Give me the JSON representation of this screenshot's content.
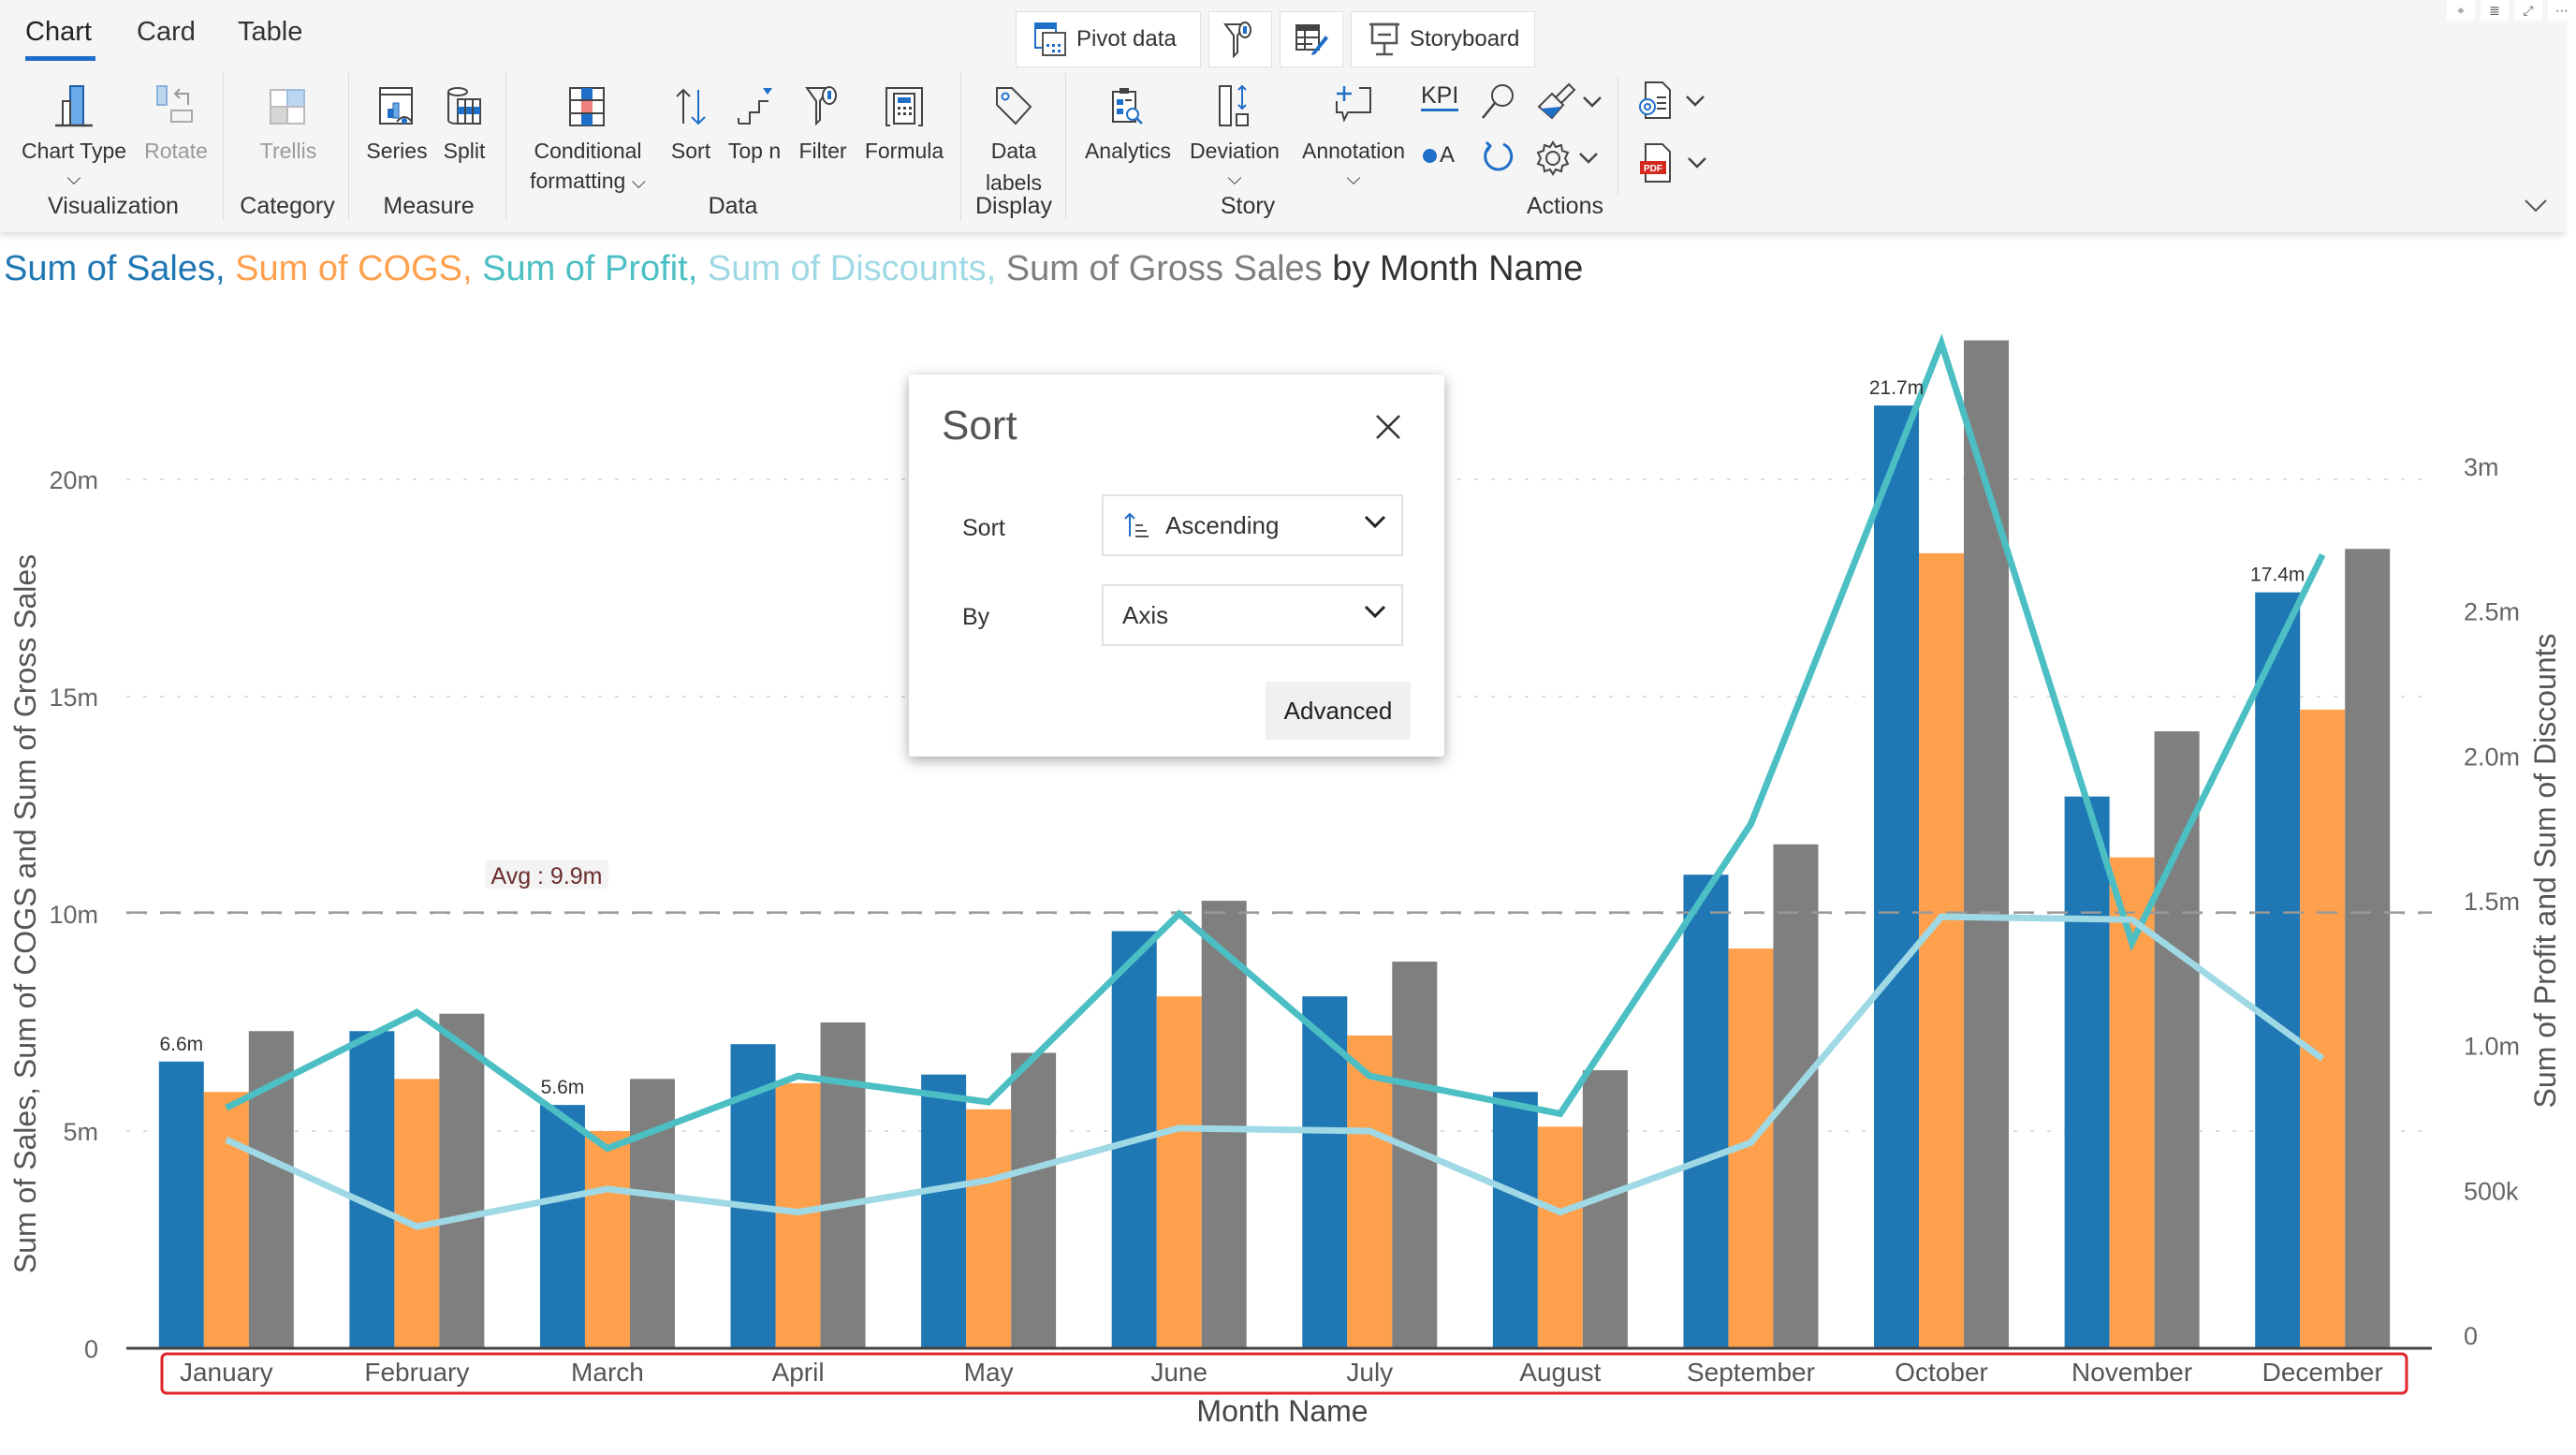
{
  "ribbon": {
    "tabs": [
      {
        "label": "Chart",
        "active": true
      },
      {
        "label": "Card",
        "active": false
      },
      {
        "label": "Table",
        "active": false
      }
    ],
    "top_buttons": {
      "pivot_data": "Pivot data",
      "storyboard": "Storyboard"
    },
    "items": {
      "chart_type": "Chart Type",
      "rotate": "Rotate",
      "trellis": "Trellis",
      "series": "Series",
      "split": "Split",
      "conditional_formatting_1": "Conditional",
      "conditional_formatting_2": "formatting",
      "sort": "Sort",
      "top_n": "Top n",
      "filter": "Filter",
      "formula": "Formula",
      "data_labels_1": "Data",
      "data_labels_2": "labels",
      "analytics": "Analytics",
      "deviation": "Deviation",
      "annotation": "Annotation",
      "kpi": "KPI"
    },
    "groups": {
      "visualization": "Visualization",
      "category": "Category",
      "measure": "Measure",
      "data": "Data",
      "display": "Display",
      "story": "Story",
      "actions": "Actions"
    },
    "icons": [
      "pin-icon",
      "filter-icon",
      "expand-icon",
      "more-icon"
    ],
    "pdf_label": "PDF"
  },
  "chart_title": {
    "parts": [
      {
        "text": "Sum of Sales, ",
        "color": "#1f77b4"
      },
      {
        "text": "Sum of COGS, ",
        "color": "#ffa04d"
      },
      {
        "text": "Sum of Profit, ",
        "color": "#4bbfc3"
      },
      {
        "text": "Sum of Discounts, ",
        "color": "#9fd9e5"
      },
      {
        "text": "Sum of Gross Sales ",
        "color": "#7f7f7f"
      },
      {
        "text": "by Month Name",
        "color": "#333333"
      }
    ]
  },
  "sort_dialog": {
    "title": "Sort",
    "sort_label": "Sort",
    "sort_value": "Ascending",
    "by_label": "By",
    "by_value": "Axis",
    "advanced_label": "Advanced"
  },
  "chart_data": {
    "type": "bar",
    "title": "Sum of Sales, Sum of COGS, Sum of Profit, Sum of Discounts, Sum of Gross Sales by Month Name",
    "xlabel": "Month Name",
    "ylabel": "Sum of Sales, Sum of COGS and Sum of Gross Sales",
    "y2label": "Sum of Profit and Sum of Discounts",
    "categories": [
      "January",
      "February",
      "March",
      "April",
      "May",
      "June",
      "July",
      "August",
      "September",
      "October",
      "November",
      "December"
    ],
    "ylim": [
      0,
      20000000
    ],
    "y_ticks": [
      {
        "v": 0,
        "label": "0"
      },
      {
        "v": 5000000,
        "label": "5m"
      },
      {
        "v": 10000000,
        "label": "10m"
      },
      {
        "v": 15000000,
        "label": "15m"
      },
      {
        "v": 20000000,
        "label": "20m"
      }
    ],
    "y2lim": [
      0,
      3000000
    ],
    "y2_ticks": [
      {
        "v": 0,
        "label": "0"
      },
      {
        "v": 500000,
        "label": "500k"
      },
      {
        "v": 1000000,
        "label": "1.0m"
      },
      {
        "v": 1500000,
        "label": "1.5m"
      },
      {
        "v": 2000000,
        "label": "2.0m"
      },
      {
        "v": 2500000,
        "label": "2.5m"
      },
      {
        "v": 3000000,
        "label": "3m"
      }
    ],
    "grid": true,
    "series": [
      {
        "name": "Sum of Sales",
        "kind": "bar",
        "axis": "left",
        "color": "#1f77b4",
        "values": [
          6600000,
          7300000,
          5600000,
          7000000,
          6300000,
          9600000,
          8100000,
          5900000,
          10900000,
          21700000,
          12700000,
          17400000
        ]
      },
      {
        "name": "Sum of COGS",
        "kind": "bar",
        "axis": "left",
        "color": "#ffa04d",
        "values": [
          5900000,
          6200000,
          5000000,
          6100000,
          5500000,
          8100000,
          7200000,
          5100000,
          9200000,
          18300000,
          11300000,
          14700000
        ]
      },
      {
        "name": "Sum of Gross Sales",
        "kind": "bar",
        "axis": "left",
        "color": "#7f7f7f",
        "values": [
          7300000,
          7700000,
          6200000,
          7500000,
          6800000,
          10300000,
          8900000,
          6400000,
          11600000,
          23200000,
          14200000,
          18400000
        ]
      },
      {
        "name": "Sum of Profit",
        "kind": "line",
        "axis": "right",
        "color": "#4bbfc3",
        "values": [
          830000,
          1160000,
          690000,
          940000,
          850000,
          1500000,
          940000,
          810000,
          1810000,
          3470000,
          1400000,
          2740000
        ]
      },
      {
        "name": "Sum of Discounts",
        "kind": "line",
        "axis": "right",
        "color": "#9fd9e5",
        "values": [
          720000,
          420000,
          550000,
          470000,
          580000,
          760000,
          750000,
          470000,
          710000,
          1490000,
          1480000,
          1000000
        ]
      }
    ],
    "data_labels": [
      {
        "category": "January",
        "series": "Sum of Sales",
        "label": "6.6m"
      },
      {
        "category": "March",
        "series": "Sum of Sales",
        "label": "5.6m"
      },
      {
        "category": "October",
        "series": "Sum of Sales",
        "label": "21.7m"
      },
      {
        "category": "December",
        "series": "Sum of Sales",
        "label": "17.4m"
      }
    ],
    "reference_line": {
      "label": "Avg : 9.9m",
      "value": 9900000,
      "axis": "left"
    },
    "highlight": "x-axis labels outlined in red"
  }
}
